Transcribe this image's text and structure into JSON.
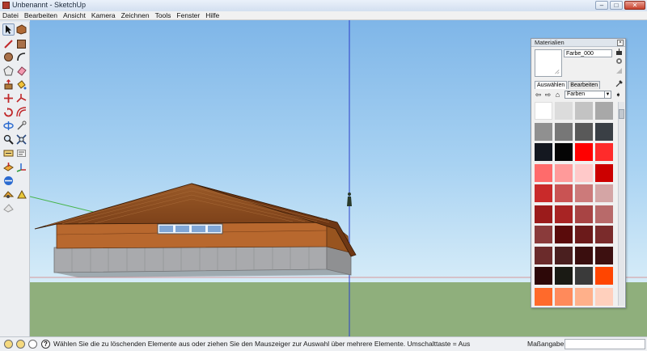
{
  "window": {
    "title": "Unbenannt - SketchUp"
  },
  "menu": [
    "Datei",
    "Bearbeiten",
    "Ansicht",
    "Kamera",
    "Zeichnen",
    "Tools",
    "Fenster",
    "Hilfe"
  ],
  "toolbar": {
    "tools": [
      "select-tool",
      "make-component-tool",
      "line-tool",
      "rectangle-tool",
      "circle-tool",
      "arc-tool",
      "polygon-tool",
      "eraser-tool",
      "push-pull-tool",
      "paint-bucket-tool",
      "move-tool",
      "follow-me-tool",
      "rotate-tool",
      "offset-tool",
      "orbit-tool",
      "tape-measure-tool",
      "zoom-tool",
      "zoom-extents-tool",
      "dimension-tool",
      "text-tool",
      "section-plane-tool",
      "axes-tool",
      "walk-tool",
      "look-around-tool",
      "position-camera-tool",
      "sandbox-tool",
      "3d-warehouse-tool"
    ]
  },
  "materials": {
    "panel_title": "Materialien",
    "material_name": "Farbe_000",
    "tabs": [
      "Auswählen",
      "Bearbeiten"
    ],
    "library": "Farben",
    "swatch_colors": [
      "#ffffff",
      "#dcdcdc",
      "#c3c3c3",
      "#a8a8a8",
      "#909090",
      "#777777",
      "#595959",
      "#3a3f45",
      "#141820",
      "#050505",
      "#ff0000",
      "#ff2b2b",
      "#ff6b6b",
      "#ff9a9a",
      "#ffc9c9",
      "#cc0000",
      "#c92a2a",
      "#c95353",
      "#cc7a7a",
      "#d4a5a5",
      "#9b1b1b",
      "#a82424",
      "#a84444",
      "#b86a6a",
      "#8a3b3b",
      "#5a0b0b",
      "#6b1a1a",
      "#7a2b2b",
      "#6b2b2b",
      "#4a1f1f",
      "#3a0e0e",
      "#3d1010",
      "#2d0808",
      "#1a1a14",
      "#3a3a3a",
      "#ff4500",
      "#ff6a2b",
      "#ff8a5b",
      "#ffb08a",
      "#ffd0bd"
    ]
  },
  "status": {
    "message": "Wählen Sie die zu löschenden Elemente aus oder ziehen Sie den Mauszeiger zur Auswahl über mehrere Elemente. Umschalttaste = Aus",
    "measure_label": "Maßangaben",
    "measure_value": ""
  },
  "colors": {
    "sky_top": "#7fb6e8",
    "sky_bottom": "#d2e8f6",
    "ground": "#8faf7c",
    "roof": "#8b4a22",
    "wall": "#b8682e",
    "foundation": "#a9aaad"
  }
}
